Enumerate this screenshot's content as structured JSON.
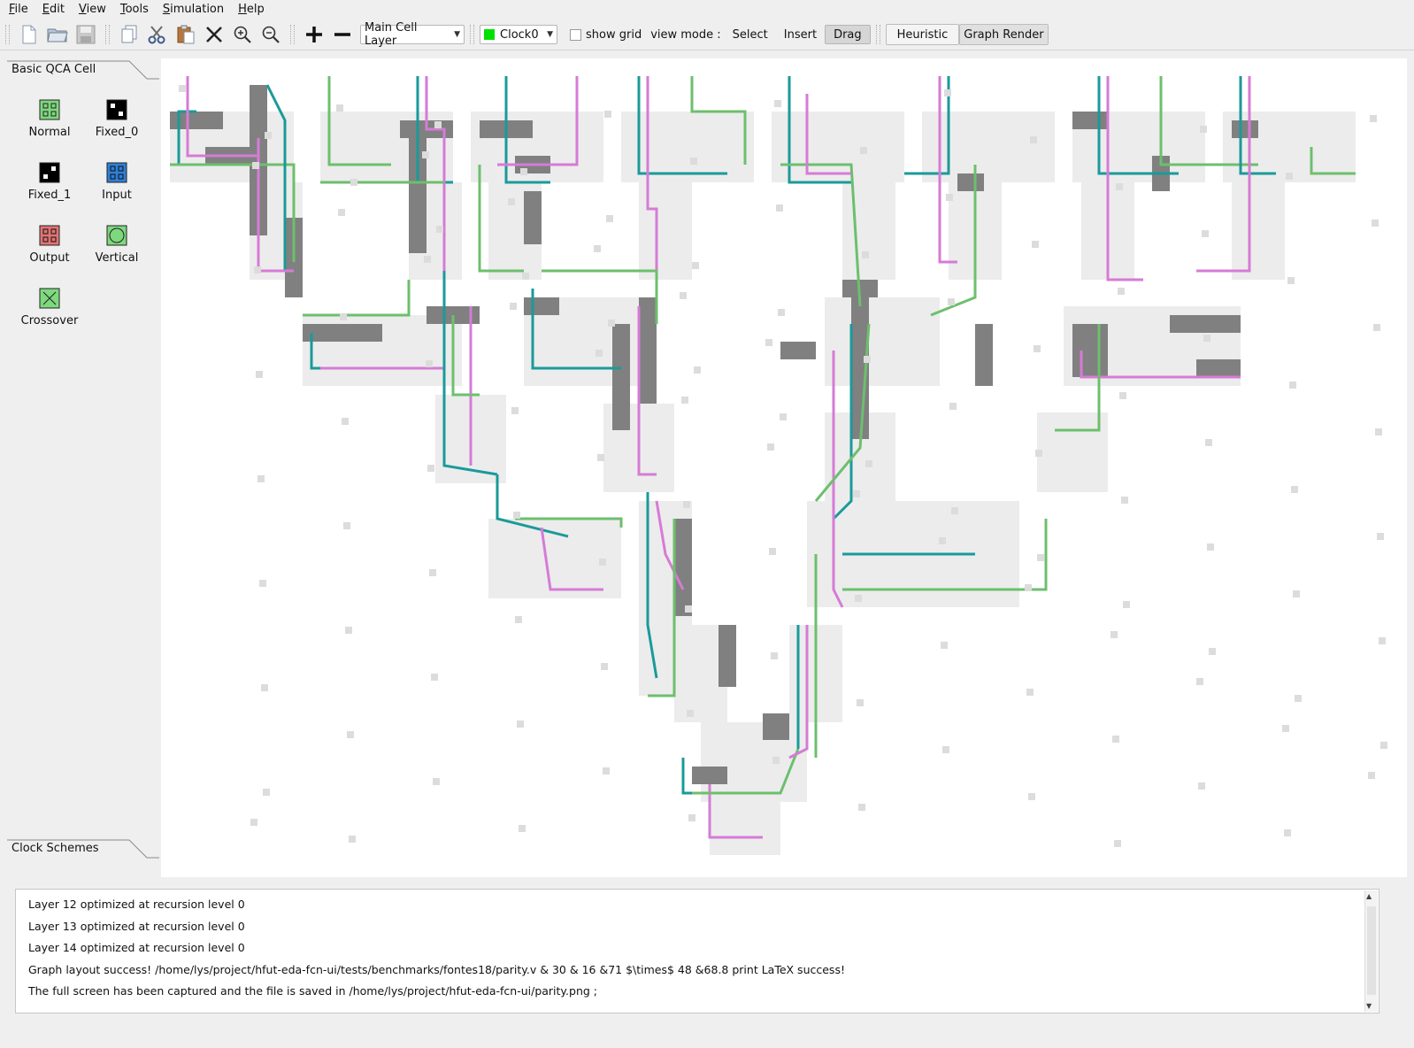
{
  "menu": [
    "File",
    "Edit",
    "View",
    "Tools",
    "Simulation",
    "Help"
  ],
  "toolbar": {
    "layer_combo": "Main Cell Layer",
    "clock_combo": "Clock0",
    "clock_color": "#00e000",
    "show_grid_label": "show grid",
    "view_mode_label": "view mode :",
    "mode_select": "Select",
    "mode_insert": "Insert",
    "mode_drag": "Drag",
    "heuristic_btn": "Heuristic",
    "graph_render_btn": "Graph Render"
  },
  "left_panel": {
    "tab_title": "Basic QCA Cell",
    "cells": [
      {
        "label": "Normal",
        "icon": "normal-cell-icon",
        "color": "#56c456"
      },
      {
        "label": "Fixed_0",
        "icon": "fixed0-cell-icon",
        "color": "#000000"
      },
      {
        "label": "Fixed_1",
        "icon": "fixed1-cell-icon",
        "color": "#000000"
      },
      {
        "label": "Input",
        "icon": "input-cell-icon",
        "color": "#2f7fd6"
      },
      {
        "label": "Output",
        "icon": "output-cell-icon",
        "color": "#e06a6a"
      },
      {
        "label": "Vertical",
        "icon": "vertical-cell-icon",
        "color": "#56c456"
      },
      {
        "label": "Crossover",
        "icon": "crossover-cell-icon",
        "color": "#56c456"
      }
    ],
    "clock_tab_title": "Clock Schemes"
  },
  "canvas": {
    "wire_colors": {
      "teal": "#1a9a9a",
      "pink": "#d67bd6",
      "green": "#6dbf6d",
      "dark": "#808080",
      "light": "#c8c8c8"
    }
  },
  "log": [
    "Layer 12 optimized at recursion level 0",
    "Layer 13 optimized at recursion level 0",
    "Layer 14 optimized at recursion level 0",
    "Graph layout success! /home/lys/project/hfut-eda-fcn-ui/tests/benchmarks/fontes18/parity.v & 30 & 16 &71 $\\times$ 48  &68.8 print LaTeX success!",
    "The full screen has been captured and the file is saved in /home/lys/project/hfut-eda-fcn-ui/parity.png ;"
  ]
}
